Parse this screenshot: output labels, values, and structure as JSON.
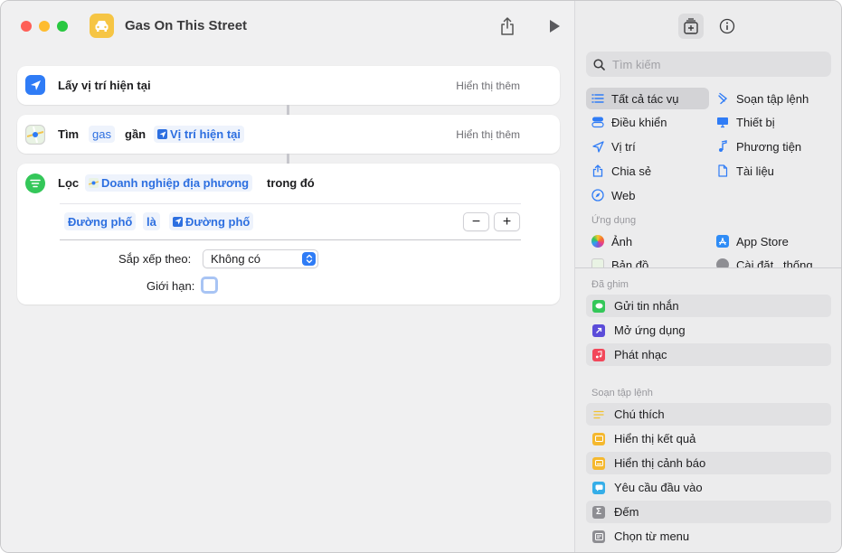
{
  "window": {
    "title": "Gas On This Street"
  },
  "actions": {
    "get_location": {
      "label": "Lấy vị trí hiện tại",
      "show_more": "Hiển thị thêm"
    },
    "find": {
      "label_find": "Tìm",
      "query": "gas",
      "label_near": "gần",
      "location_token": "Vị trí hiện tại",
      "show_more": "Hiển thị thêm"
    },
    "filter": {
      "label": "Lọc",
      "source_token": "Doanh nghiệp địa phương",
      "where_label": "trong đó",
      "condition_field": "Đường phố",
      "condition_op": "là",
      "condition_value": "Đường phố",
      "minus": "−",
      "plus": "+",
      "sort_label": "Sắp xếp theo:",
      "sort_value": "Không có",
      "limit_label": "Giới hạn:"
    }
  },
  "sidebar": {
    "search_placeholder": "Tìm kiếm",
    "categories_left": [
      "Tất cả tác vụ",
      "Điều khiển",
      "Vị trí",
      "Chia sẻ",
      "Web"
    ],
    "categories_right": [
      "Soạn tập lệnh",
      "Thiết bị",
      "Phương tiện",
      "Tài liệu"
    ],
    "apps_header": "Ứng dụng",
    "apps": [
      "Ảnh",
      "App Store",
      "Bản đồ",
      "Cài đặt...thống"
    ],
    "pinned_header": "Đã ghim",
    "pinned": [
      "Gửi tin nhắn",
      "Mở ứng dụng",
      "Phát nhạc"
    ],
    "scripting_header": "Soạn tập lệnh",
    "scripting": [
      "Chú thích",
      "Hiển thị kết quả",
      "Hiển thị cảnh báo",
      "Yêu cầu đầu vào",
      "Đếm",
      "Chọn từ menu"
    ]
  },
  "colors": {
    "accent": "#2f7cf6",
    "token_text": "#2d6fe0",
    "app_icon": "#f6c544"
  }
}
